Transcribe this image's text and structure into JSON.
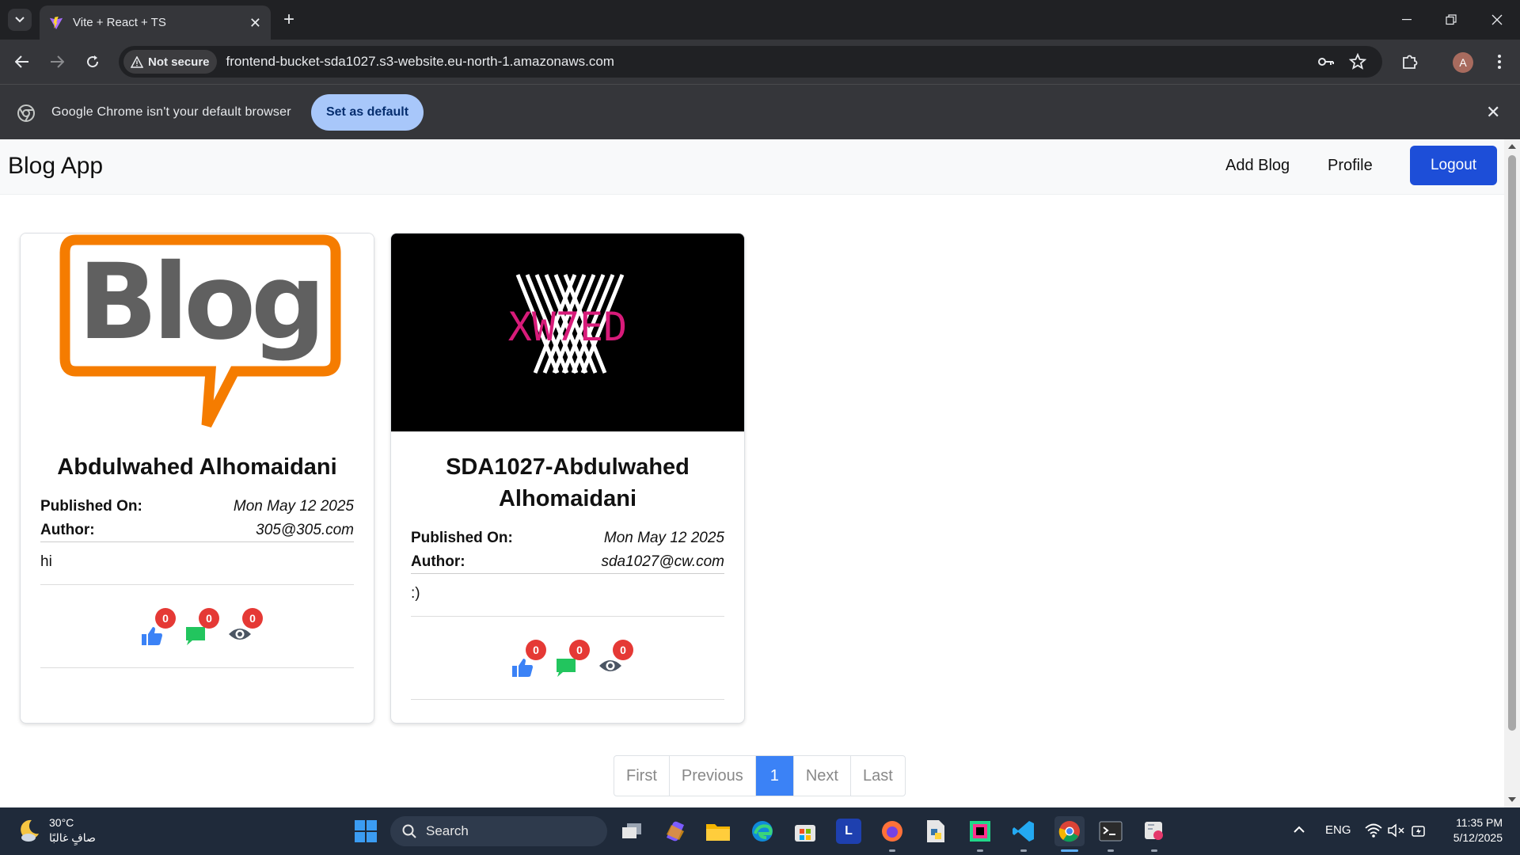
{
  "browser": {
    "tab_title": "Vite + React + TS",
    "security_label": "Not secure",
    "url": "frontend-bucket-sda1027.s3-website.eu-north-1.amazonaws.com",
    "profile_initial": "A",
    "infobar_text": "Google Chrome isn't your default browser",
    "set_default_label": "Set as default"
  },
  "navbar": {
    "brand": "Blog App",
    "links": [
      "Add Blog",
      "Profile"
    ],
    "logout_label": "Logout",
    "logout_color": "#1d4ed8"
  },
  "cards": [
    {
      "image": "blog-speech-bubble-logo",
      "title": "Abdulwahed Alhomaidani",
      "published_label": "Published On:",
      "published_value": "Mon May 12 2025",
      "author_label": "Author:",
      "author_value": "305@305.com",
      "body": "hi",
      "likes": "0",
      "comments": "0",
      "views": "0"
    },
    {
      "image": "xw7ed-logo",
      "image_text": "XW7ED",
      "title": "SDA1027-Abdulwahed Alhomaidani",
      "published_label": "Published On:",
      "published_value": "Mon May 12 2025",
      "author_label": "Author:",
      "author_value": "sda1027@cw.com",
      "body": ":)",
      "likes": "0",
      "comments": "0",
      "views": "0"
    }
  ],
  "pagination": {
    "first": "First",
    "previous": "Previous",
    "current": "1",
    "next": "Next",
    "last": "Last",
    "active_color": "#3b82f6"
  },
  "taskbar": {
    "temperature": "30°C",
    "weather_desc": "صافٍ غالبًا",
    "search_label": "Search",
    "language": "ENG",
    "time": "11:35 PM",
    "date": "5/12/2025"
  }
}
